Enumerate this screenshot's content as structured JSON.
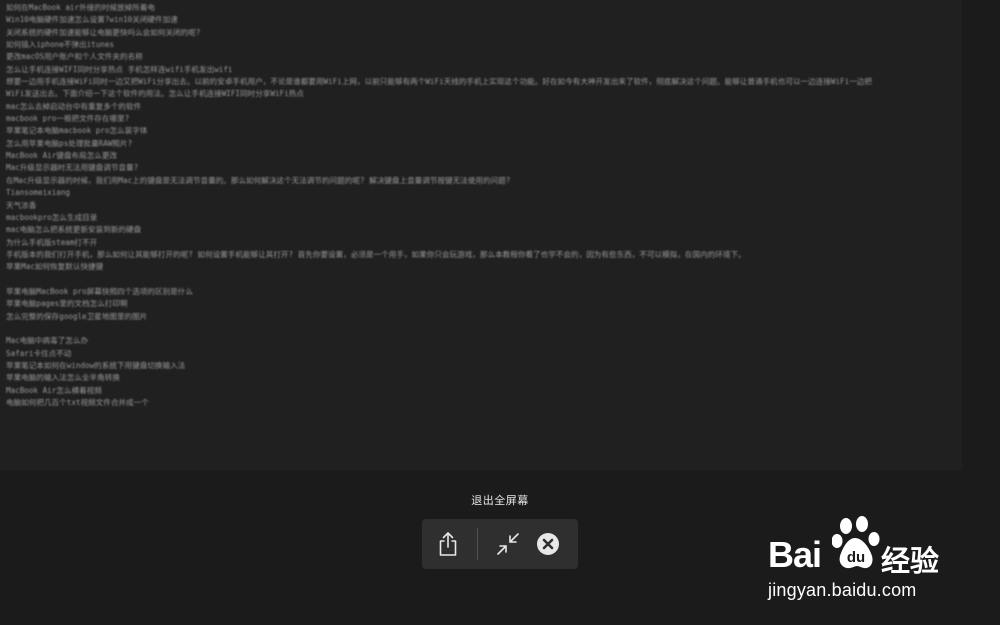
{
  "document": {
    "lines": [
      "如何在MacBook air外接的时候放掉所着电",
      "Win10电脑硬件加速怎么设置?win10关闭硬件加速",
      "关闭系统的硬件加速能够让电脑更快吗么会如何关闭的呢?",
      "如何插入iphone不弹出itunes",
      "更改macOS用户账户和个人文件夹的名称",
      "怎么让手机连接WIFI同时分享热点  手机怎样连wifi手机发出wifi",
      "想要一边用手机连接WiFi同时一边又把WiFi分享出去。以前的安卓手机用户，不论是谁都要用WiFi上网，以前只能够有两个WiFi天线的手机上实现这个功能。好在如今有大神开发出来了软件，彻底解决这个问题。能够让普通手机也可以一边连接WiFi一边把",
      "WiFi发送出去。下面介绍一下这个软件的用法。怎么让手机连接WIFI同时分享WiFi热点",
      "mac怎么去掉启动台中有重复多个的软件",
      "macbook pro一根把文件存在哪里?",
      "苹果笔记本电脑macbook pro怎么装字体",
      "怎么用苹果电脑ps处理批量RAW照片?",
      "MacBook Air键盘布局怎么更改",
      "Mac升级显示器时无法用键盘调节音量?",
      "在Mac升级显示器的时候，我们用Mac上的键盘是无法调节音量的。那么如何解决这个无法调节的问题的呢? 解决键盘上音量调节按键无法使用的问题?",
      "Tiansomeixiang",
      "天气浓香",
      "macbookpro怎么生成目录",
      "mac电脑怎么把系统更新安装到新的硬盘",
      "为什么手机版steam打不开",
      "手机版本的我们打开手机，那么如何让其能够打开的呢? 如何设置手机能够让其打开? 首先你要设置，必须是一个用手，如果你只会玩游戏，那么本教程你看了也学不会的，因为有些东西，不可以模拟，在国内的环境下。",
      "苹果Mac如何恢复默认快捷键",
      "",
      "苹果电脑MacBook pro屏幕快照四个选项的区别是什么",
      "苹果电脑pages里的文档怎么打印啊",
      "怎么完整的保存google卫星地图里的图片",
      "",
      "Mac电脑中病毒了怎么办",
      "Safari卡住点不动",
      "苹果笔记本如何在window的系统下用键盘切换输入法",
      "苹果电脑的输入法怎么全半角转换",
      "MacBook Air怎么横着视频",
      "电脑如何把几百个txt视频文件合并成一个"
    ]
  },
  "fullscreen_bar": {
    "exit_label": "退出全屏幕",
    "buttons": [
      "share",
      "exit-fullscreen",
      "close"
    ]
  },
  "watermark": {
    "brand_latin": "Bai",
    "brand_latin_suffix": "du",
    "brand_cn": "经验",
    "url": "jingyan.baidu.com"
  }
}
